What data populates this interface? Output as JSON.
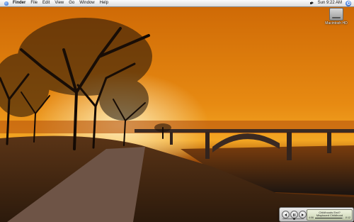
{
  "menubar": {
    "items": [
      {
        "label": "Finder"
      },
      {
        "label": "File"
      },
      {
        "label": "Edit"
      },
      {
        "label": "View"
      },
      {
        "label": "Go"
      },
      {
        "label": "Window"
      },
      {
        "label": "Help"
      }
    ],
    "clock": "Sun 9:22 AM",
    "right_icons": [
      "speaker-icon",
      "spotlight-icon"
    ]
  },
  "desktop": {
    "icons": [
      {
        "label": "Macintosh HD",
        "icon": "hard-drive-icon"
      }
    ]
  },
  "player": {
    "title": "Childhoods End?",
    "subtitle": "Misplaced Childhood",
    "elapsed": "4:06",
    "remaining": "-0:12",
    "progress": 0.95,
    "volume": 0.55,
    "buttons": [
      "previous-icon",
      "pause-icon",
      "next-icon"
    ]
  },
  "colors": {
    "sky_top": "#d9730b",
    "sky_glow": "#f6a51e",
    "ground": "#3b2412"
  }
}
